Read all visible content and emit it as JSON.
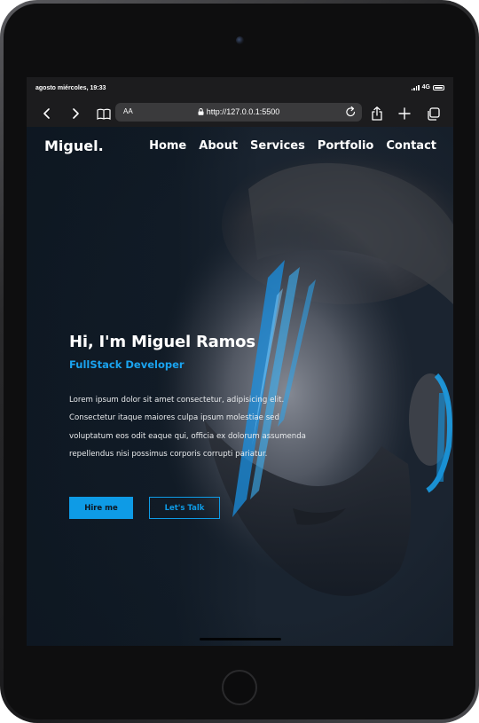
{
  "status_bar": {
    "time": "agosto miércoles, 19:33",
    "network": "4G"
  },
  "browser": {
    "text_size_label": "AA",
    "url": "http://127.0.0.1:5500",
    "icons": [
      "back-icon",
      "forward-icon",
      "book-icon",
      "lock-icon",
      "reload-icon",
      "share-icon",
      "plus-icon",
      "tabs-icon"
    ]
  },
  "site": {
    "brand": "Miguel.",
    "nav": [
      "Home",
      "About",
      "Services",
      "Portfolio",
      "Contact"
    ],
    "hero": {
      "title": "Hi, I'm Miguel Ramos",
      "subtitle": "FullStack Developer",
      "text": "Lorem ipsum dolor sit amet consectetur, adipisicing elit. Consectetur itaque maiores culpa ipsum molestiae sed voluptatum eos odit eaque qui, officia ex dolorum assumenda repellendus nisi possimus corporis corrupti pariatur.",
      "primary_button": "Hire me",
      "secondary_button": "Let's Talk"
    }
  },
  "colors": {
    "accent": "#0e9be6",
    "background": "#0d1620"
  }
}
